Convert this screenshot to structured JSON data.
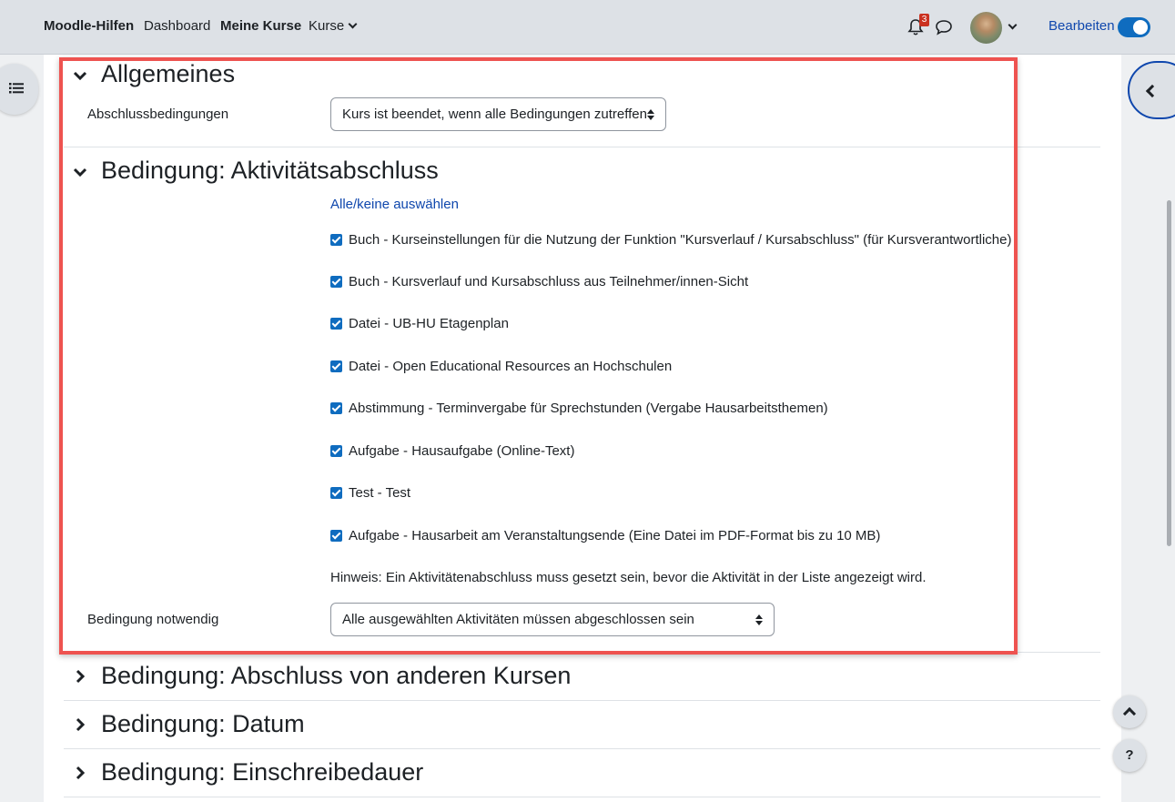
{
  "navbar": {
    "brand": "Moodle-Hilfen",
    "links": [
      "Dashboard",
      "Meine Kurse",
      "Kurse"
    ],
    "notification_count": "3",
    "edit_label": "Bearbeiten",
    "edit_mode_on": true
  },
  "sections": {
    "general": {
      "title": "Allgemeines",
      "field_label": "Abschlussbedingungen",
      "field_value": "Kurs ist beendet, wenn alle Bedingungen zutreffen"
    },
    "activity": {
      "title": "Bedingung: Aktivitätsabschluss",
      "select_all_link": "Alle/keine auswählen",
      "items": [
        "Buch - Kurseinstellungen für die Nutzung der Funktion \"Kursverlauf / Kursabschluss\" (für Kursverantwortliche)",
        "Buch - Kursverlauf und Kursabschluss aus Teilnehmer/innen-Sicht",
        "Datei - UB-HU Etagenplan",
        "Datei - Open Educational Resources an Hochschulen",
        "Abstimmung - Terminvergabe für Sprechstunden (Vergabe Hausarbeitsthemen)",
        "Aufgabe - Hausaufgabe (Online-Text)",
        "Test - Test",
        "Aufgabe - Hausarbeit am Veranstaltungsende (Eine Datei im PDF-Format bis zu 10 MB)"
      ],
      "hint": "Hinweis: Ein Aktivitätenabschluss muss gesetzt sein, bevor die Aktivität in der Liste angezeigt wird.",
      "required_label": "Bedingung notwendig",
      "required_value": "Alle ausgewählten Aktivitäten müssen abgeschlossen sein"
    },
    "collapsed": [
      "Bedingung: Abschluss von anderen Kursen",
      "Bedingung: Datum",
      "Bedingung: Einschreibedauer"
    ]
  },
  "help_button": "?",
  "colors": {
    "accent": "#0f6cbf",
    "link": "#0f47ad",
    "highlight": "#ee5350",
    "badge": "#ca3120"
  }
}
